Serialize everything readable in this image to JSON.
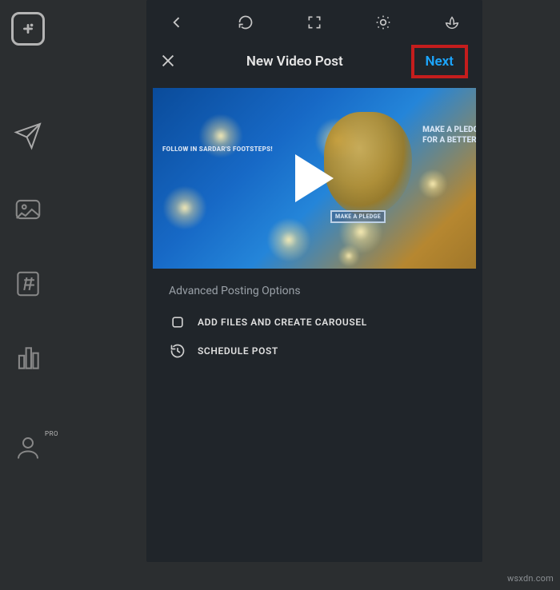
{
  "sidebar": {
    "pro_label": "PRO"
  },
  "header": {
    "title": "New Video Post",
    "next_label": "Next"
  },
  "video": {
    "follow_text": "FOLLOW IN SARDAR'S FOOTSTEPS!",
    "pledge_line1": "MAKE A PLEDG",
    "pledge_line2": "FOR A BETTER I",
    "pledge_button": "MAKE A PLEDGE"
  },
  "advanced": {
    "section_title": "Advanced Posting Options",
    "add_files": "ADD FILES AND CREATE CAROUSEL",
    "schedule": "SCHEDULE POST"
  },
  "watermark": "wsxdn.com"
}
